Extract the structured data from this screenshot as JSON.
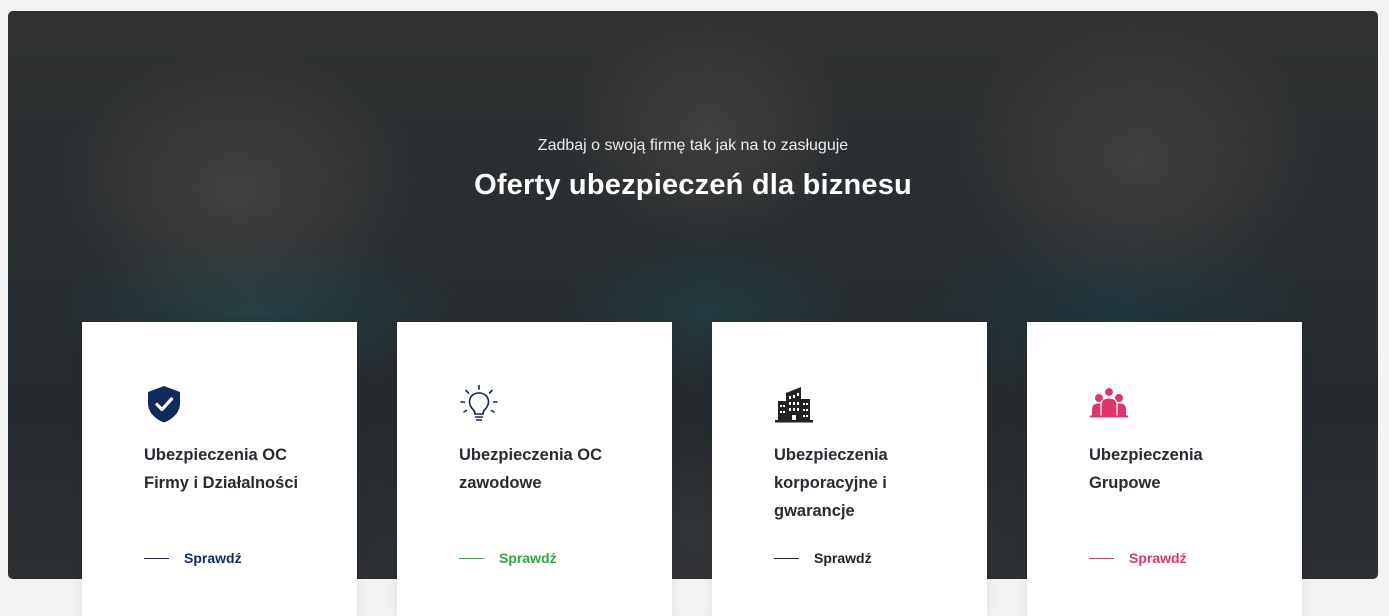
{
  "hero": {
    "subtitle": "Zadbaj o swoją firmę tak jak na to zasługuje",
    "title": "Oferty ubezpieczeń dla biznesu"
  },
  "cards": [
    {
      "title": "Ubezpieczenia OC Firmy i Działalności",
      "link_label": "Sprawdź",
      "icon": "shield-check-icon",
      "accent": "#0f2a5c"
    },
    {
      "title": "Ubezpieczenia OC zawodowe",
      "link_label": "Sprawdź",
      "icon": "lightbulb-icon",
      "accent": "#2aa845"
    },
    {
      "title": "Ubezpieczenia korporacyjne i gwarancje",
      "link_label": "Sprawdź",
      "icon": "office-building-icon",
      "accent": "#222222"
    },
    {
      "title": "Ubezpieczenia Grupowe",
      "link_label": "Sprawdź",
      "icon": "group-people-icon",
      "accent": "#e0356b"
    }
  ]
}
